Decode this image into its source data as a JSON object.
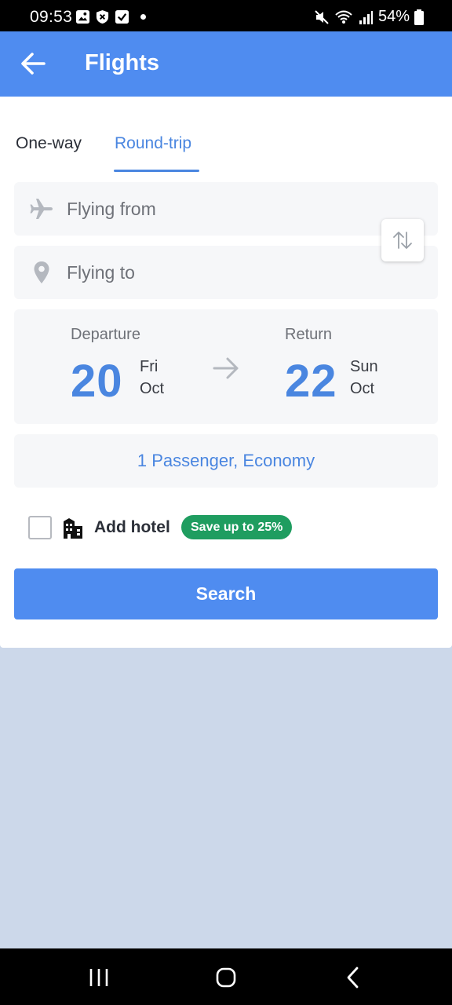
{
  "status_bar": {
    "time": "09:53",
    "battery": "54%"
  },
  "app_bar": {
    "title": "Flights",
    "back_icon": "arrow-left-icon"
  },
  "trip_tabs": [
    {
      "label": "One-way",
      "selected": false
    },
    {
      "label": "Round-trip",
      "selected": true
    }
  ],
  "route": {
    "from_placeholder": "Flying from",
    "to_placeholder": "Flying to",
    "from_icon": "airplane-icon",
    "to_icon": "location-pin-icon",
    "swap_icon": "swap-vertical-icon"
  },
  "dates": {
    "departure": {
      "label": "Departure",
      "day": "20",
      "weekday": "Fri",
      "month": "Oct"
    },
    "return": {
      "label": "Return",
      "day": "22",
      "weekday": "Sun",
      "month": "Oct"
    }
  },
  "passengers": {
    "text": "1 Passenger, Economy"
  },
  "hotel": {
    "label": "Add hotel",
    "badge": "Save up to 25%",
    "checked": false,
    "icon": "hotel-building-icon"
  },
  "search_button": {
    "label": "Search"
  },
  "colors": {
    "primary": "#4f8cf0",
    "accent_text": "#4a86e0",
    "badge_green": "#1f9d60",
    "background": "#ccd8ea"
  }
}
